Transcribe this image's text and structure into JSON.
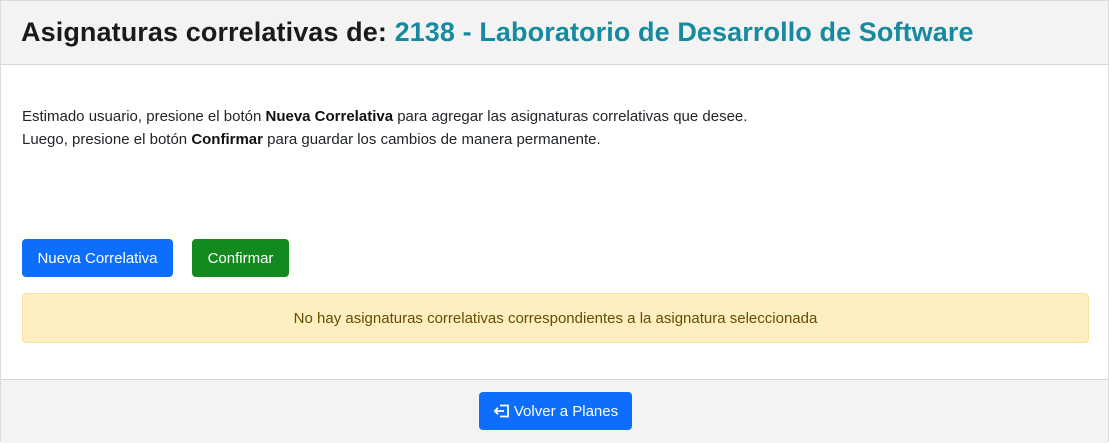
{
  "header": {
    "title_prefix": "Asignaturas correlativas de:",
    "subject": "2138 - Laboratorio de Desarrollo de Software"
  },
  "instructions": {
    "line1_start": "Estimado usuario, presione el botón ",
    "line1_bold": "Nueva Correlativa",
    "line1_end": " para agregar las asignaturas correlativas que desee.",
    "line2_start": "Luego, presione el botón ",
    "line2_bold": "Confirmar",
    "line2_end": " para guardar los cambios de manera permanente."
  },
  "buttons": {
    "new": "Nueva Correlativa",
    "confirm": "Confirmar",
    "back": "Volver a Planes"
  },
  "alert": {
    "message": "No hay asignaturas correlativas correspondientes a la asignatura seleccionada"
  },
  "colors": {
    "subject": "#178aa0",
    "primary": "#0d6efd",
    "success": "#128a1f",
    "alert_bg": "#fdefc0"
  },
  "icons": {
    "back": "box-arrow-left-icon"
  }
}
